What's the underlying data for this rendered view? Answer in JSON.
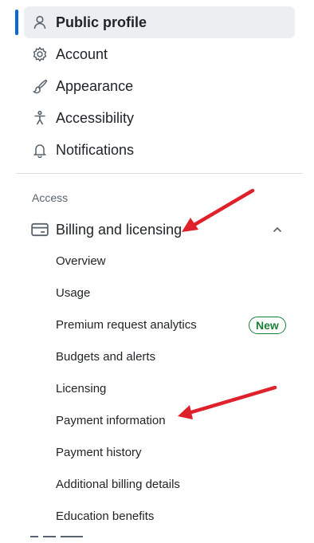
{
  "sidebar": {
    "items": [
      {
        "label": "Public profile",
        "icon": "person-icon",
        "active": true
      },
      {
        "label": "Account",
        "icon": "gear-icon"
      },
      {
        "label": "Appearance",
        "icon": "paintbrush-icon"
      },
      {
        "label": "Accessibility",
        "icon": "accessibility-icon"
      },
      {
        "label": "Notifications",
        "icon": "bell-icon"
      }
    ]
  },
  "access": {
    "heading": "Access",
    "billing": {
      "label": "Billing and licensing",
      "icon": "credit-card-icon",
      "expanded": true,
      "children": [
        {
          "label": "Overview"
        },
        {
          "label": "Usage"
        },
        {
          "label": "Premium request analytics",
          "badge": "New"
        },
        {
          "label": "Budgets and alerts"
        },
        {
          "label": "Licensing"
        },
        {
          "label": "Payment information"
        },
        {
          "label": "Payment history"
        },
        {
          "label": "Additional billing details"
        },
        {
          "label": "Education benefits"
        }
      ]
    }
  },
  "colors": {
    "accent": "#0969da",
    "active_bg": "#eceef1",
    "badge_green": "#1a7f37",
    "annotation_arrow": "#e0202a"
  }
}
